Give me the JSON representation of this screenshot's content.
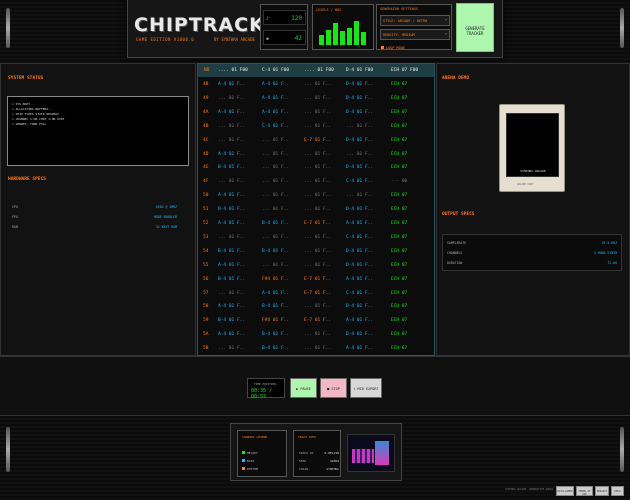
{
  "header": {
    "logo": "CHIPTRACKER",
    "subtitle": "GAME EDITION V1000.0",
    "by": "BY SYNTHRA ARCADE",
    "stats": [
      {
        "label": "♪",
        "value": "120"
      },
      {
        "label": "▪",
        "value": "42"
      }
    ],
    "meter_title": "LEVELS / BUS",
    "meter_levels": [
      0.35,
      0.55,
      0.8,
      0.5,
      0.6,
      0.85,
      0.45
    ],
    "settings_title": "GENERATOR SETTINGS",
    "select_1": "STYLE: ARCADE / RETRO",
    "select_2": "DENSITY: MEDIUM",
    "loop_label": "LOOP MODE",
    "generate_label": "GENERATE TRACKER"
  },
  "system_status": {
    "title": "SYSTEM STATUS",
    "lines": [
      "> SYS BOOT...",
      "> ALLOCATING BUFFERS...",
      "> CHIP TYPES STATE READOUT",
      "> CHANNEL 1:ON CHIP 1:ON STRT",
      "> GENRES: TONE FULL"
    ]
  },
  "hardware": {
    "title": "HARDWARE SPECS",
    "rows": [
      {
        "label": "CPU",
        "value": "6502 @ 1MHZ"
      },
      {
        "label": "FPU",
        "value": "MODE ENABLED"
      },
      {
        "label": "RAM",
        "value": "32 KBYT RAM"
      }
    ]
  },
  "tracker": {
    "headers": [
      "NO",
      ".... 01 F00",
      "C-4 01 F00",
      ".... 01 F00",
      "D-4 01 F00",
      "ECH 07 F00"
    ],
    "rows": [
      {
        "n": "48",
        "c": [
          "A-4 01 F..",
          "A-4 01 F..",
          "... 01 F..",
          "D-4 01 F..",
          "ECH 07"
        ]
      },
      {
        "n": "49",
        "c": [
          "... 01 F..",
          "A-4 01 F..",
          "... 01 F..",
          "D-4 01 F..",
          "ECH 07"
        ]
      },
      {
        "n": "4A",
        "c": [
          "A-4 01 F..",
          "A-4 01 F..",
          "... 01 F..",
          "D-4 01 F..",
          "ECH 07"
        ]
      },
      {
        "n": "4B",
        "c": [
          "... 01 F..",
          "C-4 01 F..",
          "... 01 F..",
          "... 01 F..",
          "ECH 07"
        ]
      },
      {
        "n": "4C",
        "c": [
          "... 01 F..",
          "... 01 F..",
          "E-7 01 F..",
          "D-4 01 F..",
          "ECH 07"
        ]
      },
      {
        "n": "4D",
        "c": [
          "A-4 01 F..",
          "... 01 F..",
          "... 01 F..",
          "... 01 F..",
          "ECH 07"
        ]
      },
      {
        "n": "4E",
        "c": [
          "B-4 01 F..",
          "... 01 F..",
          "... 01 F..",
          "D-4 01 F..",
          "ECH 07"
        ]
      },
      {
        "n": "4F",
        "c": [
          "... 01 F..",
          "... 01 F..",
          "... 01 F..",
          "C-4 01 F..",
          "--- 00"
        ]
      },
      {
        "n": "50",
        "c": [
          "A-4 01 F..",
          "... 01 F..",
          "... 01 F..",
          "... 01 F..",
          "ECH 07"
        ]
      },
      {
        "n": "51",
        "c": [
          "B-4 01 F..",
          "... 01 F..",
          "... 01 F..",
          "D-4 01 F..",
          "ECH 07"
        ]
      },
      {
        "n": "52",
        "c": [
          "A-4 01 F..",
          "B-4 01 F..",
          "E-7 01 F..",
          "A-4 01 F..",
          "ECH 07"
        ]
      },
      {
        "n": "53",
        "c": [
          "... 01 F..",
          "... 01 F..",
          "... 01 F..",
          "C-4 01 F..",
          "ECH 07"
        ]
      },
      {
        "n": "54",
        "c": [
          "B-4 01 F..",
          "B-4 01 F..",
          "... 01 F..",
          "D-4 01 F..",
          "ECH 07"
        ]
      },
      {
        "n": "55",
        "c": [
          "A-4 01 F..",
          "... 01 F..",
          "... 01 F..",
          "D-4 01 F..",
          "ECH 07"
        ]
      },
      {
        "n": "56",
        "c": [
          "B-4 01 F..",
          "F#4 01 F..",
          "E-7 01 F..",
          "A-4 01 F..",
          "ECH 07"
        ]
      },
      {
        "n": "57",
        "c": [
          "... 01 F..",
          "A-4 01 F..",
          "E-7 01 F..",
          "C-4 01 F..",
          "ECH 07"
        ]
      },
      {
        "n": "58",
        "c": [
          "A-4 01 F..",
          "B-4 01 F..",
          "... 01 F..",
          "D-4 01 F..",
          "ECH 07"
        ]
      },
      {
        "n": "59",
        "c": [
          "B-4 01 F..",
          "F#4 01 F..",
          "E-7 01 F..",
          "A-4 01 F..",
          "ECH 07"
        ]
      },
      {
        "n": "5A",
        "c": [
          "A-4 01 F..",
          "B-4 01 F..",
          "... 01 F..",
          "D-4 01 F..",
          "ECH 07"
        ]
      },
      {
        "n": "5B",
        "c": [
          "... 01 F..",
          "B-4 01 F..",
          "... 01 F..",
          "A-4 01 F..",
          "ECH 07"
        ]
      }
    ]
  },
  "arena": {
    "title": "ARENA DEMO",
    "screen_text": "SYNTHRA ARCADE",
    "caption": "ARCADE UNIT"
  },
  "output": {
    "title": "OUTPUT SPECS",
    "rows": [
      {
        "label": "SAMPLERATE",
        "value": "35.5 KHZ"
      },
      {
        "label": "CHANNELS",
        "value": "4 MONO SYNTH"
      },
      {
        "label": "DURATION",
        "value": "72.00"
      }
    ]
  },
  "transport": {
    "display_title": "TIME POSITION",
    "display_value": "00:35 / 00:57",
    "play": "▶ PAUSE",
    "stop": "■ STOP",
    "export": "⬇ MID EXPORT"
  },
  "footer": {
    "legend_title": "CHANNEL LEGEND",
    "legend": [
      {
        "label": "MELODY",
        "color": "#19e619"
      },
      {
        "label": "BASS",
        "color": "#1ab8ff"
      },
      {
        "label": "RHYTHM",
        "color": "#ff7a1a"
      }
    ],
    "nft_title": "TRACK INFO",
    "nft_rows": [
      {
        "label": "TRACK ID",
        "value": "0-0ELVIN"
      },
      {
        "label": "SEED",
        "value": "42069"
      },
      {
        "label": "CHAIN",
        "value": "SYNTHRA"
      }
    ],
    "legal": "SYNTHRA ARCADE. GENERATIVE AUDIO.",
    "links": [
      "DISCLAIMER",
      "TERMS OF USE",
      "PRIVACY",
      "DMCA"
    ]
  }
}
